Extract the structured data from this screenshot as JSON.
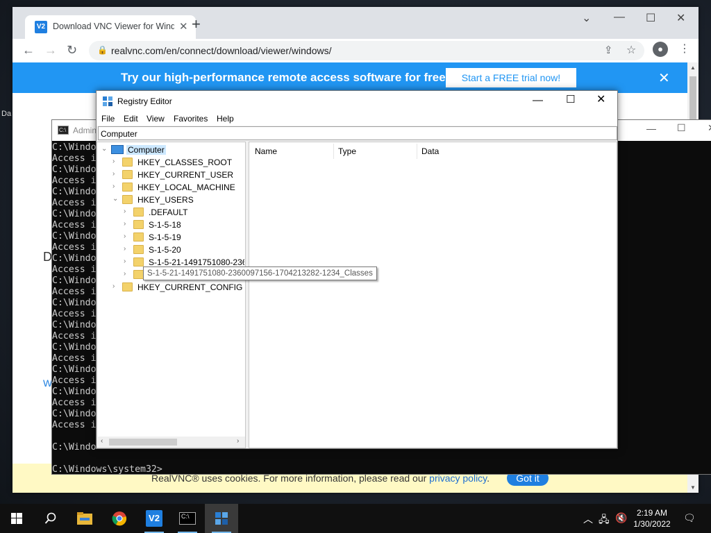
{
  "browser": {
    "tab_title": "Download VNC Viewer for Windows",
    "favicon_text": "V2",
    "url": "realvnc.com/en/connect/download/viewer/windows/",
    "banner_text": "Try our high-performance remote access software for free",
    "banner_button": "Start a FREE trial now!",
    "cookie_text": "RealVNC® uses cookies. For more information, please read our",
    "cookie_link": "privacy policy",
    "cookie_dot": ".",
    "cookie_button": "Got it"
  },
  "cmd": {
    "title": "Admin",
    "lines": [
      "C:\\Windo",
      "Access i",
      "C:\\Windo",
      "Access i",
      "C:\\Windo",
      "Access i",
      "C:\\Windo",
      "Access i",
      "C:\\Windo",
      "Access i",
      "C:\\Windo",
      "Access i",
      "C:\\Windo",
      "Access i",
      "C:\\Windo",
      "Access i",
      "C:\\Windo",
      "Access i",
      "C:\\Windo",
      "Access i",
      "C:\\Windo",
      "Access i",
      "C:\\Windo",
      "Access i",
      "C:\\Windo",
      "Access i",
      "",
      "C:\\Windo",
      "",
      "C:\\Windows\\system32>"
    ]
  },
  "regedit": {
    "title": "Registry Editor",
    "menu": [
      "File",
      "Edit",
      "View",
      "Favorites",
      "Help"
    ],
    "address": "Computer",
    "columns": [
      "Name",
      "Type",
      "Data"
    ],
    "tree": {
      "root": "Computer",
      "hives": [
        "HKEY_CLASSES_ROOT",
        "HKEY_CURRENT_USER",
        "HKEY_LOCAL_MACHINE",
        "HKEY_USERS"
      ],
      "users_children": [
        ".DEFAULT",
        "S-1-5-18",
        "S-1-5-19",
        "S-1-5-20",
        "S-1-5-21-1491751080-2360"
      ],
      "last_hive": "HKEY_CURRENT_CONFIG"
    },
    "tooltip": "S-1-5-21-1491751080-2360097156-1704213282-1234_Classes"
  },
  "desktop": {
    "label_da": "Da",
    "label_d": "D",
    "label_w": "W"
  },
  "taskbar": {
    "time": "2:19 AM",
    "date": "1/30/2022"
  }
}
